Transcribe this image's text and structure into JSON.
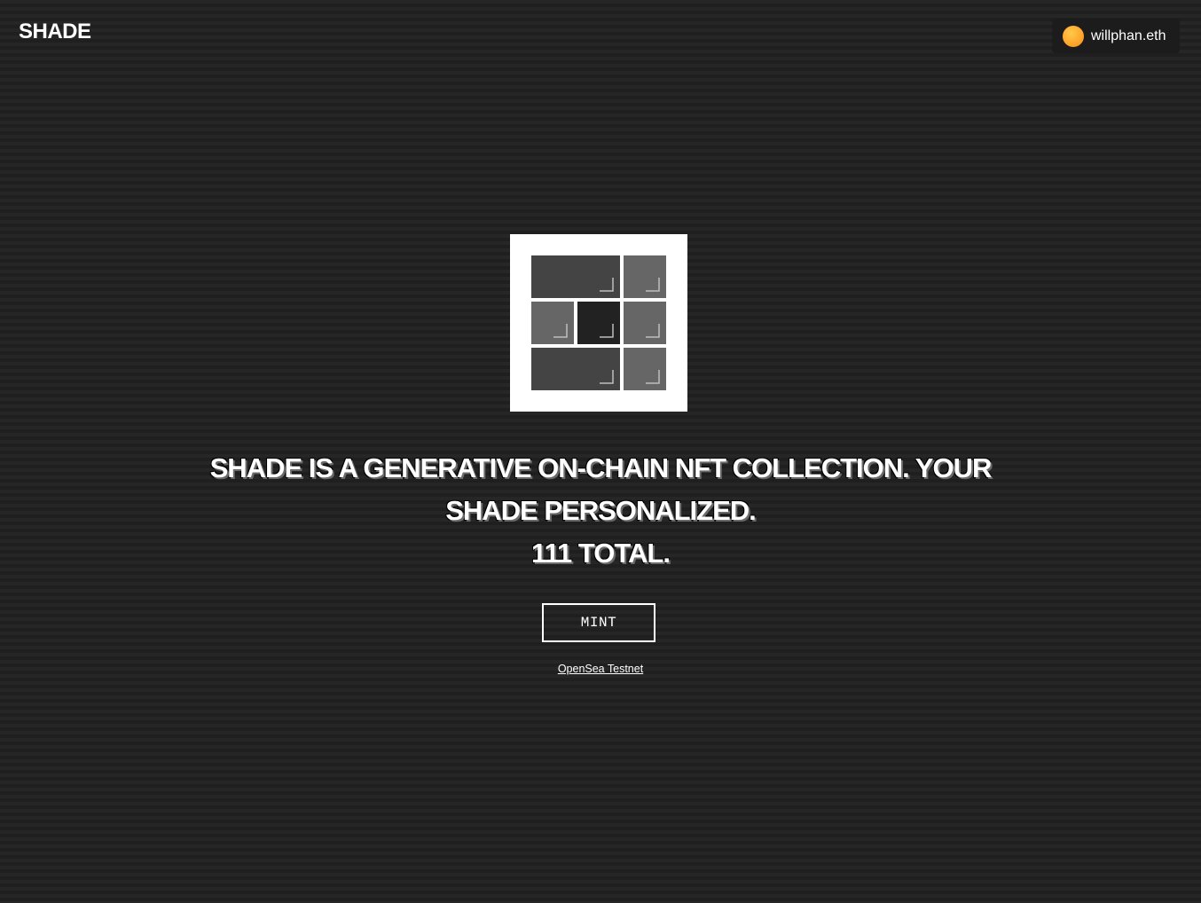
{
  "header": {
    "logo": "SHADE",
    "account": {
      "name": "willphan.eth",
      "avatar_color": "#ffa52a"
    }
  },
  "artwork": {
    "frame_color": "#ffffff",
    "tiles": [
      {
        "shade": "#444444"
      },
      {
        "shade": "#666666"
      },
      {
        "shade": "#666666"
      },
      {
        "shade": "#222222"
      },
      {
        "shade": "#666666"
      },
      {
        "shade": "#444444"
      },
      {
        "shade": "#666666"
      }
    ]
  },
  "main": {
    "headline_line1": "SHADE IS A GENERATIVE ON-CHAIN NFT COLLECTION. YOUR",
    "headline_line2": "SHADE PERSONALIZED.",
    "headline_line3": "111 TOTAL.",
    "mint_label": "MINT",
    "opensea_link": "OpenSea Testnet"
  },
  "colors": {
    "background": "#242424",
    "text": "#ffffff"
  }
}
